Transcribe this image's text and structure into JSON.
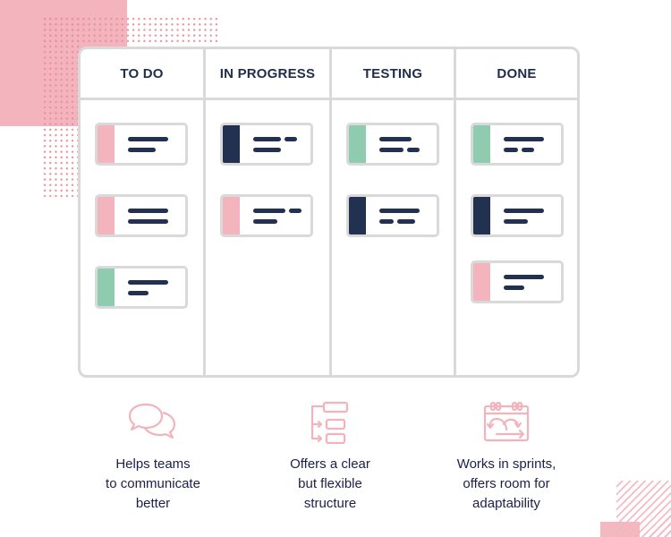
{
  "colors": {
    "pink": "#f3b4bd",
    "green": "#8ecbaf",
    "navy": "#22314f",
    "border": "#d9d9d9",
    "text": "#1b1f4a",
    "icon": "#f2b3bc"
  },
  "board": {
    "columns": [
      {
        "title": "TO DO",
        "cards": [
          {
            "color": "pink",
            "lines": [
              [
                1
              ],
              [
                0.7
              ]
            ]
          },
          {
            "color": "pink",
            "lines": [
              [
                1
              ],
              [
                1
              ]
            ]
          },
          {
            "color": "green",
            "lines": [
              [
                1
              ],
              [
                0.5
              ]
            ]
          }
        ]
      },
      {
        "title": "IN PROGRESS",
        "cards": [
          {
            "color": "navy",
            "lines": [
              [
                0.7,
                0.3
              ],
              [
                0.7
              ]
            ]
          },
          {
            "color": "pink",
            "lines": [
              [
                0.8,
                0.3
              ],
              [
                0.6
              ]
            ]
          }
        ]
      },
      {
        "title": "TESTING",
        "cards": [
          {
            "color": "green",
            "lines": [
              [
                0.8
              ],
              [
                0.6,
                0.3
              ]
            ]
          },
          {
            "color": "navy",
            "lines": [
              [
                1
              ],
              [
                0.35,
                0.45
              ]
            ]
          }
        ]
      },
      {
        "title": "DONE",
        "cards": [
          {
            "color": "green",
            "lines": [
              [
                1
              ],
              [
                0.35,
                0.3
              ]
            ]
          },
          {
            "color": "navy",
            "lines": [
              [
                1
              ],
              [
                0.6
              ]
            ]
          },
          {
            "color": "pink",
            "lines": [
              [
                1
              ],
              [
                0.5
              ]
            ]
          }
        ]
      }
    ]
  },
  "benefits": [
    {
      "icon": "chat-bubbles-icon",
      "text": "Helps teams\nto communicate\nbetter"
    },
    {
      "icon": "structure-icon",
      "text": "Offers a clear\nbut flexible\nstructure"
    },
    {
      "icon": "sprint-calendar-icon",
      "text": "Works in sprints,\noffers room for\nadaptability"
    }
  ]
}
